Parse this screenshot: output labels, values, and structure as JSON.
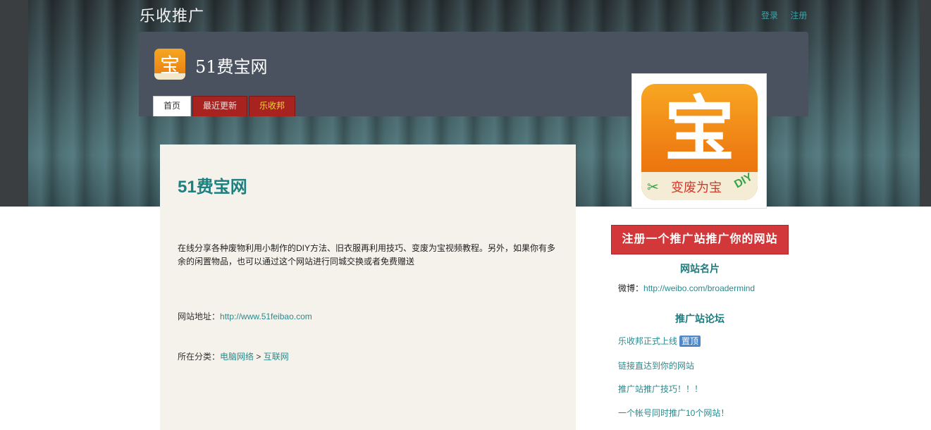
{
  "site": {
    "title": "乐收推广",
    "login_label": "登录",
    "register_label": "注册"
  },
  "header": {
    "logo_glyph": "宝",
    "page_title": "51费宝网",
    "tabs": [
      {
        "label": "首页",
        "active": true
      },
      {
        "label": "最近更新",
        "active": false
      },
      {
        "label": "乐收邦",
        "active": false
      }
    ]
  },
  "main": {
    "heading": "51费宝网",
    "description": "在线分享各种废物利用小制作的DIY方法、旧衣服再利用技巧、变废为宝视频教程。另外，如果你有多余的闲置物品，也可以通过这个网站进行同城交换或者免费赠送",
    "url_label": "网站地址：",
    "url_value": "http://www.51feibao.com",
    "category_label": "所在分类：",
    "category_parent": "电脑网络",
    "category_sep": ">",
    "category_child": "互联网"
  },
  "side": {
    "logo_glyph": "宝",
    "logo_ribbon_text": "变废为宝",
    "logo_diy": "DIY",
    "register_button": "注册一个推广站推广你的网站",
    "card_heading": "网站名片",
    "weibo_label": "微博：",
    "weibo_url": "http://weibo.com/broadermind",
    "forum_heading": "推广站论坛",
    "forum_items": [
      {
        "text": "乐收邦正式上线",
        "badge": "置顶"
      },
      {
        "text": "链接直达到你的网站",
        "badge": ""
      },
      {
        "text": "推广站推广技巧！！！",
        "badge": ""
      },
      {
        "text": "一个帐号同时推广10个网站！",
        "badge": ""
      }
    ]
  },
  "colors": {
    "accent_teal": "#1e8080",
    "tab_red": "#a8231f",
    "register_red": "#d2373a",
    "badge_blue": "#4e88c7"
  }
}
